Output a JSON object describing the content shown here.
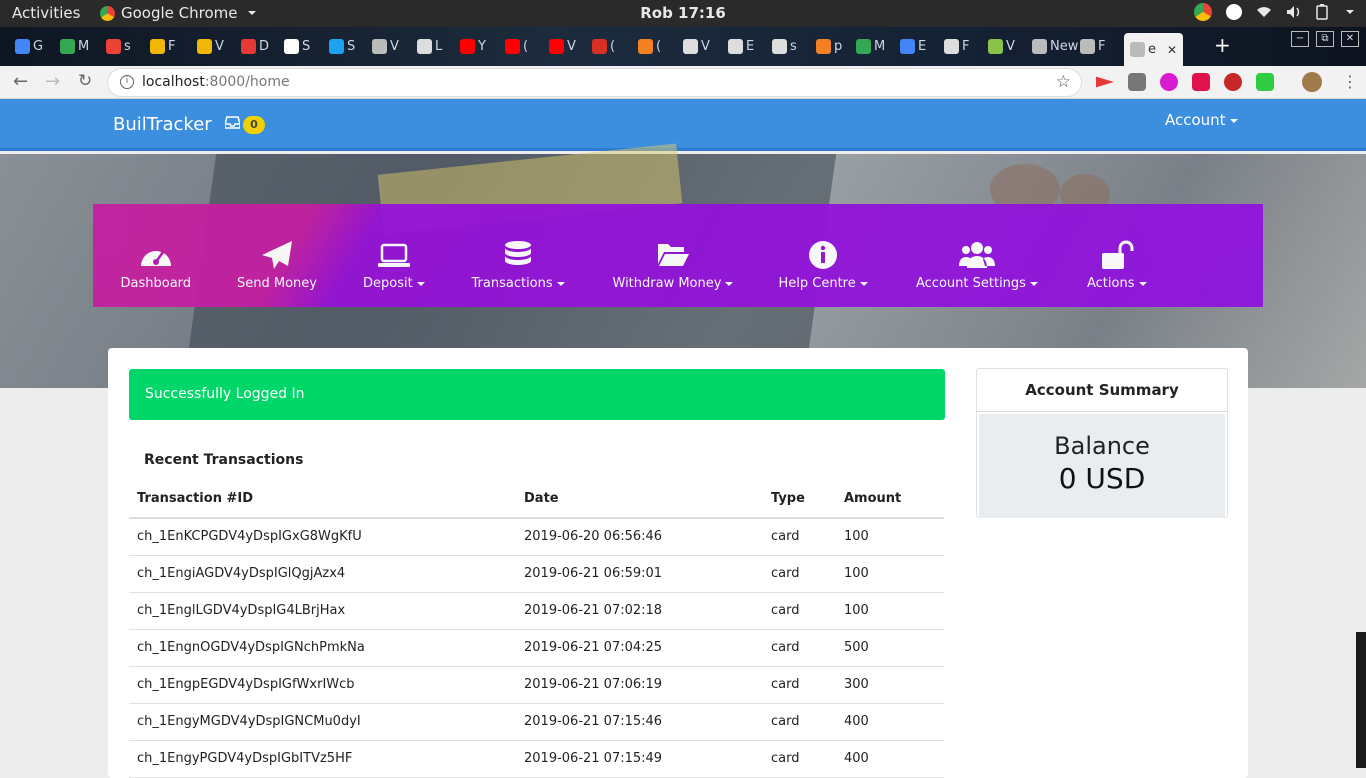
{
  "os_bar": {
    "activities": "Activities",
    "app_name": "Google Chrome",
    "clock": "Rob 17:16"
  },
  "browser": {
    "tabs": [
      {
        "label": "G",
        "icon": "google-icon",
        "color": "#4285f4"
      },
      {
        "label": "M",
        "icon": "drive-icon",
        "color": "#34a853"
      },
      {
        "label": "s",
        "icon": "google-icon",
        "color": "#ea4335"
      },
      {
        "label": "F",
        "icon": "bookmark-icon",
        "color": "#f2b705"
      },
      {
        "label": "V",
        "icon": "bookmark-icon",
        "color": "#f2b705"
      },
      {
        "label": "D",
        "icon": "star-icon",
        "color": "#e53935"
      },
      {
        "label": "S",
        "icon": "wikipedia-icon",
        "color": "#ffffff"
      },
      {
        "label": "S",
        "icon": "twitter-icon",
        "color": "#1da1f2"
      },
      {
        "label": "V",
        "icon": "page-icon",
        "color": "#bbbbbb"
      },
      {
        "label": "L",
        "icon": "film-icon",
        "color": "#dddddd"
      },
      {
        "label": "Y",
        "icon": "youtube-icon",
        "color": "#ff0000"
      },
      {
        "label": "(",
        "icon": "youtube-icon",
        "color": "#ff0000"
      },
      {
        "label": "V",
        "icon": "youtube-icon",
        "color": "#ff0000"
      },
      {
        "label": "(",
        "icon": "gmail-icon",
        "color": "#d93025"
      },
      {
        "label": "(",
        "icon": "stackoverflow-icon",
        "color": "#f48024"
      },
      {
        "label": "V",
        "icon": "github-icon",
        "color": "#dddddd"
      },
      {
        "label": "E",
        "icon": "github-icon",
        "color": "#dddddd"
      },
      {
        "label": "s",
        "icon": "github-icon",
        "color": "#dddddd"
      },
      {
        "label": "p",
        "icon": "stackoverflow-icon",
        "color": "#f48024"
      },
      {
        "label": "M",
        "icon": "drive-icon",
        "color": "#34a853"
      },
      {
        "label": "E",
        "icon": "mdb-icon",
        "color": "#4285f4"
      },
      {
        "label": "F",
        "icon": "github-icon",
        "color": "#dddddd"
      },
      {
        "label": "V",
        "icon": "tree-icon",
        "color": "#8bc34a"
      },
      {
        "label": "New",
        "icon": "page-icon",
        "color": "#bbbbbb"
      },
      {
        "label": "F",
        "icon": "page-icon",
        "color": "#bbbbbb"
      },
      {
        "label": "e",
        "icon": "page-icon",
        "color": "#bbbbbb"
      }
    ],
    "url_host": "localhost",
    "url_path": ":8000/home"
  },
  "app": {
    "brand": "BuilTracker",
    "inbox_count": "0",
    "account_menu": "Account",
    "menu": [
      {
        "label": "Dashboard",
        "icon": "dashboard-gauge-icon",
        "dropdown": false
      },
      {
        "label": "Send Money",
        "icon": "paper-plane-icon",
        "dropdown": false
      },
      {
        "label": "Deposit",
        "icon": "laptop-icon",
        "dropdown": true
      },
      {
        "label": "Transactions",
        "icon": "database-icon",
        "dropdown": true
      },
      {
        "label": "Withdraw Money",
        "icon": "folder-open-icon",
        "dropdown": true
      },
      {
        "label": "Help Centre",
        "icon": "info-circle-icon",
        "dropdown": true
      },
      {
        "label": "Account Settings",
        "icon": "users-icon",
        "dropdown": true
      },
      {
        "label": "Actions",
        "icon": "unlock-icon",
        "dropdown": true
      }
    ],
    "alert": "Successfully Logged In",
    "recent_title": "Recent Transactions",
    "table": {
      "headers": [
        "Transaction #ID",
        "Date",
        "Type",
        "Amount"
      ],
      "rows": [
        [
          "ch_1EnKCPGDV4yDspIGxG8WgKfU",
          "2019-06-20 06:56:46",
          "card",
          "100"
        ],
        [
          "ch_1EngiAGDV4yDspIGlQgjAzx4",
          "2019-06-21 06:59:01",
          "card",
          "100"
        ],
        [
          "ch_1EnglLGDV4yDspIG4LBrjHax",
          "2019-06-21 07:02:18",
          "card",
          "100"
        ],
        [
          "ch_1EngnOGDV4yDspIGNchPmkNa",
          "2019-06-21 07:04:25",
          "card",
          "500"
        ],
        [
          "ch_1EngpEGDV4yDspIGfWxrIWcb",
          "2019-06-21 07:06:19",
          "card",
          "300"
        ],
        [
          "ch_1EngyMGDV4yDspIGNCMu0dyI",
          "2019-06-21 07:15:46",
          "card",
          "400"
        ],
        [
          "ch_1EngyPGDV4yDspIGbITVz5HF",
          "2019-06-21 07:15:49",
          "card",
          "400"
        ]
      ]
    },
    "summary": {
      "title": "Account Summary",
      "balance_label": "Balance",
      "balance_value": "0 USD"
    }
  },
  "colors": {
    "app_bar": "#3c8ede",
    "menu_left": "#c420a0",
    "menu_right": "#8f15dd",
    "alert": "#00d768",
    "badge": "#f0d000"
  }
}
